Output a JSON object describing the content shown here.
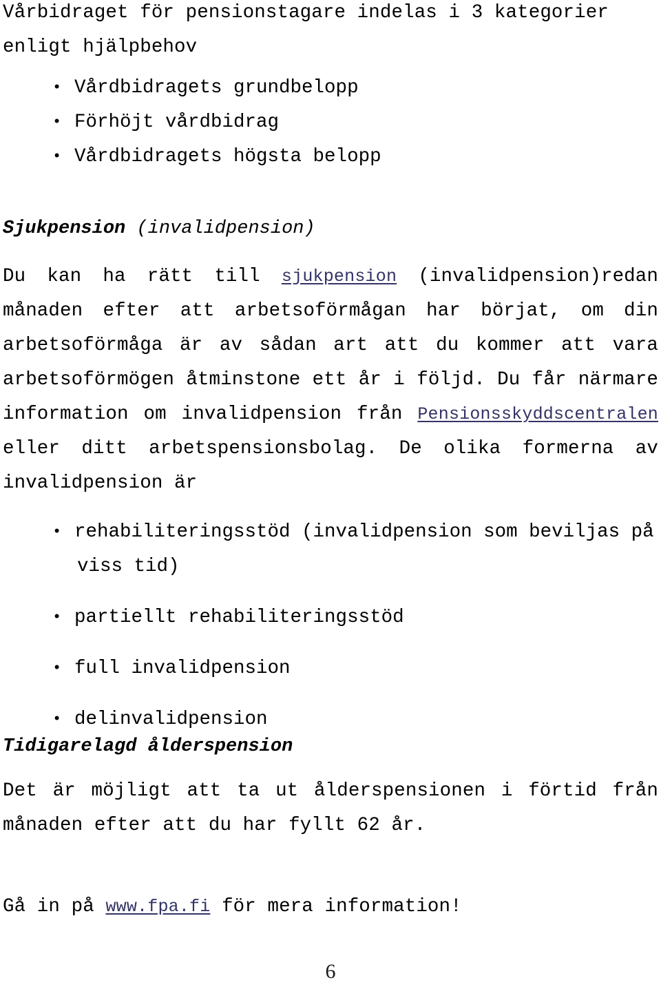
{
  "document": {
    "language": "sv",
    "page_number": "6",
    "link_color": "#333366",
    "text_color": "#000000",
    "background_color": "#ffffff"
  },
  "intro": {
    "paragraph": "Vårbidraget för pensionstagare indelas i 3 kategorier enligt hjälpbehov",
    "bullets": [
      "Vårdbidragets grundbelopp",
      "Förhöjt vårdbidrag",
      "Vårdbidragets högsta belopp"
    ],
    "bullet_glyph": "•"
  },
  "sjukpension_section": {
    "heading_bold": "Sjukpension",
    "heading_italic": " (invalidpension)",
    "paragraph": {
      "before_link": "Du kan ha rätt till ",
      "link_1": "sjukpension",
      "middle_1": " (invalidpension)redan månaden efter att arbetsoförmågan har börjat, om din arbetsoförmåga är av sådan art att du kommer att vara arbetsoförmögen åtminstone ett år i följd. Du får närmare information om invalidpension från ",
      "link_2": "Pensionsskyddscentralen",
      "after_link": " eller ditt arbetspensionsbolag. De olika formerna av invalidpension är"
    },
    "bullets": [
      {
        "line1": "rehabiliteringsstöd (invalidpension som beviljas på",
        "line2": "viss tid)"
      },
      {
        "line1": "partiellt rehabiliteringsstöd",
        "line2": ""
      },
      {
        "line1": "full invalidpension",
        "line2": ""
      },
      {
        "line1": "delinvalidpension",
        "line2": ""
      }
    ],
    "bullet_glyph": "•"
  },
  "tidigarelagd_section": {
    "heading": "Tidigarelagd ålderspension",
    "paragraph": "Det är möjligt att ta ut ålderspensionen i förtid från månaden efter att du har fyllt 62 år."
  },
  "footer_note": {
    "before_link": "Gå in på ",
    "link": "www.fpa.fi",
    "after_link": " för mera information!"
  }
}
